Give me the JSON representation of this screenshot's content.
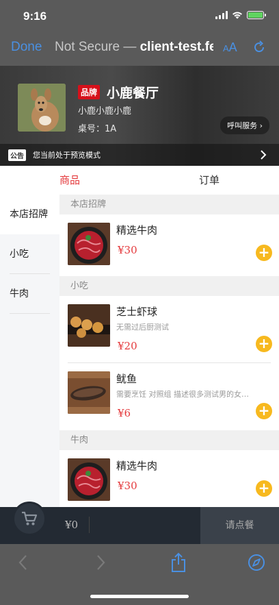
{
  "status_bar": {
    "time": "9:16"
  },
  "browser": {
    "done_label": "Done",
    "security_label": "Not Secure —",
    "host": "client-test.fe",
    "text_size_label_small": "A",
    "text_size_label_large": "A"
  },
  "shop": {
    "brand_tag": "品牌",
    "name": "小鹿餐厅",
    "subtitle": "小鹿小鹿小鹿",
    "table_number": "桌号：1A",
    "call_service_label": "呼叫服务 ›",
    "notice_tag": "公告",
    "notice_text": "您当前处于预览模式"
  },
  "tabs": [
    {
      "label": "商品",
      "active": true
    },
    {
      "label": "订单",
      "active": false
    }
  ],
  "sidebar": {
    "items": [
      {
        "label": "本店招牌",
        "active": true
      },
      {
        "label": "小吃",
        "active": false
      },
      {
        "label": "牛肉",
        "active": false
      }
    ]
  },
  "menu": {
    "sections": [
      {
        "title": "本店招牌",
        "items": [
          {
            "name": "精选牛肉",
            "desc": "",
            "price": "¥30",
            "image": "beef"
          }
        ]
      },
      {
        "title": "小吃",
        "items": [
          {
            "name": "芝士虾球",
            "desc": "无需过后厨测试",
            "price": "¥20",
            "image": "shrimp-balls"
          },
          {
            "name": "鱿鱼",
            "desc": "需要烹饪 对照组 描述很多测试男的女…",
            "price": "¥6",
            "image": "squid"
          }
        ]
      },
      {
        "title": "牛肉",
        "items": [
          {
            "name": "精选牛肉",
            "desc": "",
            "price": "¥30",
            "image": "beef"
          }
        ]
      }
    ]
  },
  "cart": {
    "total": "¥0",
    "order_button_label": "请点餐"
  },
  "colors": {
    "accent_red": "#e4393c",
    "brand_red": "#d6101a",
    "add_button": "#f7b91f",
    "ios_blue": "#4a90e2",
    "cart_bar": "#232a33"
  }
}
